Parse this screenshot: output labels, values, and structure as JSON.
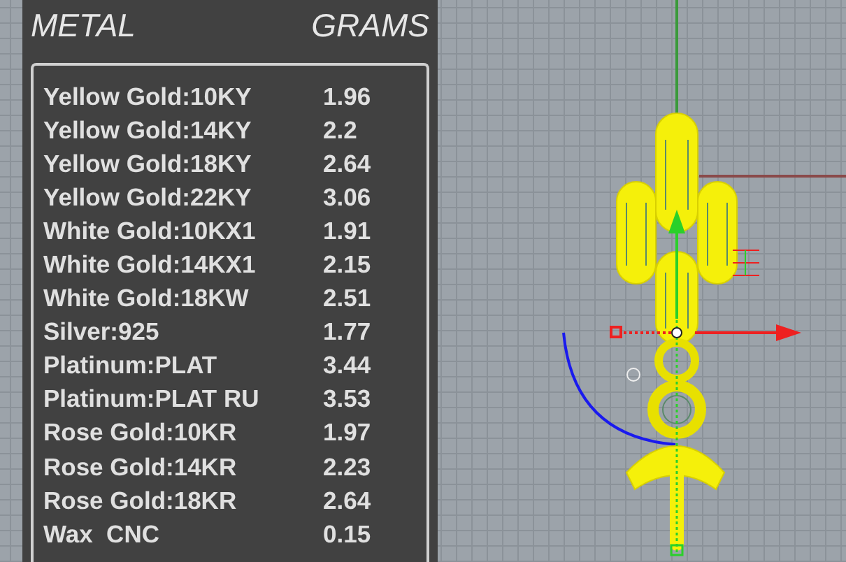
{
  "panel": {
    "header": {
      "metal": "METAL",
      "grams": "GRAMS"
    },
    "rows": [
      {
        "metal": "Yellow Gold:10KY",
        "grams": "1.96"
      },
      {
        "metal": "Yellow Gold:14KY",
        "grams": "2.2"
      },
      {
        "metal": "Yellow Gold:18KY",
        "grams": "2.64"
      },
      {
        "metal": "Yellow Gold:22KY",
        "grams": "3.06"
      },
      {
        "metal": "White Gold:10KX1",
        "grams": "1.91"
      },
      {
        "metal": "White Gold:14KX1",
        "grams": "2.15"
      },
      {
        "metal": "White Gold:18KW",
        "grams": "2.51"
      },
      {
        "metal": "Silver:925",
        "grams": "1.77"
      },
      {
        "metal": "Platinum:PLAT",
        "grams": "3.44"
      },
      {
        "metal": "Platinum:PLAT RU",
        "grams": "3.53"
      },
      {
        "metal": "Rose Gold:10KR",
        "grams": "1.97"
      },
      {
        "metal": "Rose Gold:14KR",
        "grams": "2.23"
      },
      {
        "metal": "Rose Gold:18KR",
        "grams": "2.64"
      },
      {
        "metal": "Wax  CNC",
        "grams": "0.15"
      }
    ]
  }
}
